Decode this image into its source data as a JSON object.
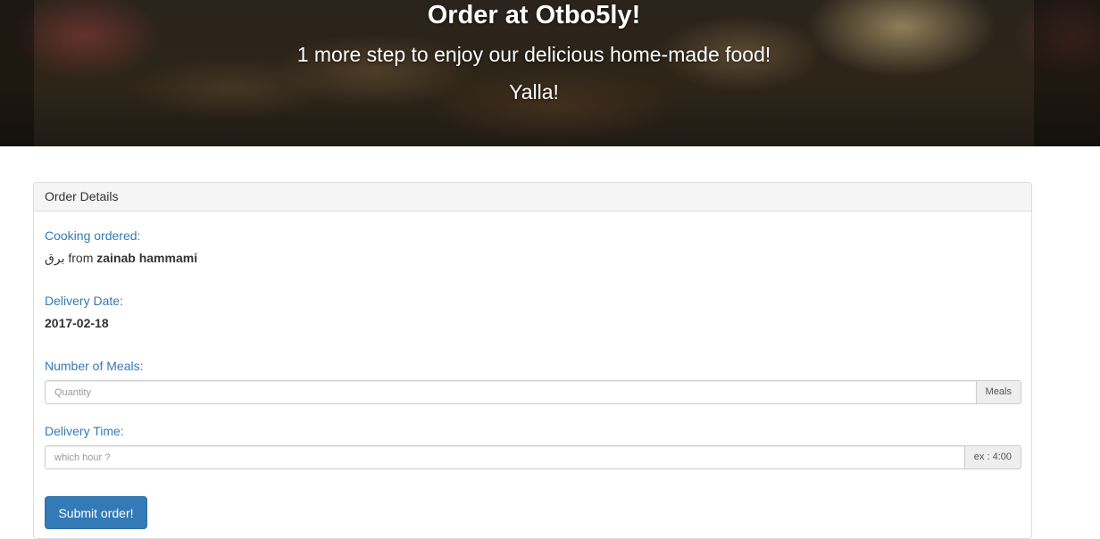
{
  "hero": {
    "title": "Order at Otbo5ly!",
    "subtitle": "1 more step to enjoy our delicious home-made food!",
    "tagline": "Yalla!"
  },
  "panel": {
    "heading": "Order Details",
    "cooking": {
      "label": "Cooking ordered:",
      "dish": "برق",
      "from_text": "from",
      "cook": "zainab hammami"
    },
    "delivery_date": {
      "label": "Delivery Date:",
      "value": "2017-02-18"
    },
    "meals": {
      "label": "Number of Meals:",
      "placeholder": "Quantity",
      "value": "",
      "addon": "Meals"
    },
    "delivery_time": {
      "label": "Delivery Time:",
      "placeholder": "which hour ?",
      "value": "",
      "addon": "ex : 4:00"
    },
    "submit_label": "Submit order!"
  },
  "colors": {
    "label_blue": "#337ab7",
    "button_blue": "#337ab7",
    "panel_heading_bg": "#f5f5f5"
  }
}
